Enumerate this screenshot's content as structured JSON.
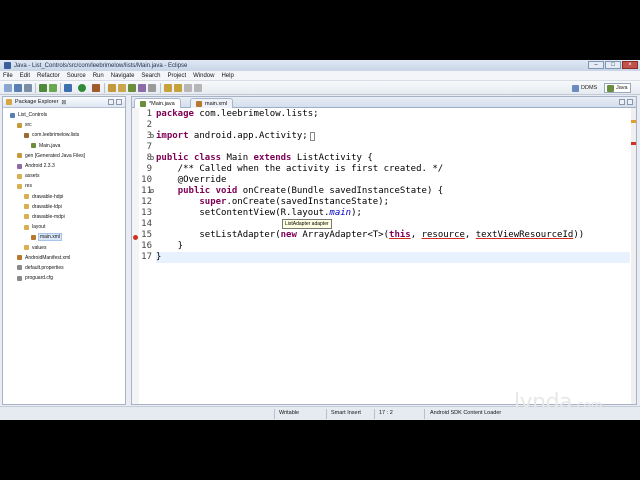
{
  "window": {
    "title": "Java - List_Controls/src/com/leebrimelow/lists/Main.java - Eclipse"
  },
  "menu": [
    "File",
    "Edit",
    "Refactor",
    "Source",
    "Run",
    "Navigate",
    "Search",
    "Project",
    "Window",
    "Help"
  ],
  "perspectives": [
    "DDMS",
    "Java"
  ],
  "explorer": {
    "title": "Package Explorer",
    "items": [
      {
        "label": "List_Controls",
        "depth": 1,
        "icon": "project-icon",
        "color": "#5a7fb8"
      },
      {
        "label": "src",
        "depth": 2,
        "icon": "source-folder-icon",
        "color": "#c49a3a"
      },
      {
        "label": "com.leebrimelow.lists",
        "depth": 3,
        "icon": "package-icon",
        "color": "#9a6a2e"
      },
      {
        "label": "Main.java",
        "depth": 4,
        "icon": "java-file-icon",
        "color": "#6c8d3b"
      },
      {
        "label": "gen [Generated Java Files]",
        "depth": 2,
        "icon": "source-folder-icon",
        "color": "#c49a3a"
      },
      {
        "label": "Android 2.3.3",
        "depth": 2,
        "icon": "library-icon",
        "color": "#8c6aa8"
      },
      {
        "label": "assets",
        "depth": 2,
        "icon": "folder-icon",
        "color": "#d9b050"
      },
      {
        "label": "res",
        "depth": 2,
        "icon": "folder-icon",
        "color": "#d9b050"
      },
      {
        "label": "drawable-hdpi",
        "depth": 3,
        "icon": "folder-icon",
        "color": "#d9b050"
      },
      {
        "label": "drawable-ldpi",
        "depth": 3,
        "icon": "folder-icon",
        "color": "#d9b050"
      },
      {
        "label": "drawable-mdpi",
        "depth": 3,
        "icon": "folder-icon",
        "color": "#d9b050"
      },
      {
        "label": "layout",
        "depth": 3,
        "icon": "folder-icon",
        "color": "#d9b050"
      },
      {
        "label": "main.xml",
        "depth": 4,
        "icon": "xml-file-icon",
        "color": "#b57a2e",
        "selected": true
      },
      {
        "label": "values",
        "depth": 3,
        "icon": "folder-icon",
        "color": "#d9b050"
      },
      {
        "label": "AndroidManifest.xml",
        "depth": 2,
        "icon": "xml-file-icon",
        "color": "#b57a2e"
      },
      {
        "label": "default.properties",
        "depth": 2,
        "icon": "file-icon",
        "color": "#8a8a8a"
      },
      {
        "label": "proguard.cfg",
        "depth": 2,
        "icon": "file-icon",
        "color": "#8a8a8a"
      }
    ]
  },
  "editor": {
    "tabs": [
      {
        "label": "*Main.java",
        "active": true
      },
      {
        "label": "main.xml",
        "active": false
      }
    ],
    "line_numbers": [
      "1",
      "2",
      "3",
      "7",
      "8",
      "9",
      "10",
      "11",
      "12",
      "13",
      "14",
      "15",
      "16",
      "17"
    ],
    "code": {
      "l1_kw": "package",
      "l1_rest": " com.leebrimelow.lists;",
      "l3_kw": "import",
      "l3_rest": " android.app.Activity;",
      "l8_kw1": "public",
      "l8_kw2": "class",
      "l8_mid": " Main ",
      "l8_kw3": "extends",
      "l8_rest": " ListActivity {",
      "l9": "    /** Called when the activity is first created. */",
      "l10": "    @Override",
      "l11_kw1": "public",
      "l11_kw2": "void",
      "l11_rest": " onCreate(Bundle savedInstanceState) {",
      "l12_kw": "super",
      "l12_rest": ".onCreate(savedInstanceState);",
      "l13_a": "setContentView(R.layout.",
      "l13_it": "main",
      "l13_b": ");",
      "l15_a": "setListAdapter(",
      "l15_kw1": "new",
      "l15_b": " ArrayAdapter<T>(",
      "l15_kw2": "this",
      "l15_c": ", ",
      "l15_u1": "resource",
      "l15_d": ", ",
      "l15_u2": "textViewResourceId",
      "l15_e": "))",
      "l16": "    }",
      "l17": "}"
    },
    "tooltip": "ListAdapter adapter"
  },
  "status": {
    "mode": "Writable",
    "insert": "Smart Insert",
    "position": "17 : 2",
    "loader": "Android SDK Content Loader"
  },
  "watermark": {
    "brand": "lynda",
    "suffix": ".com"
  },
  "colors": {
    "keyword": "#7f0055",
    "comment": "#3f5fbf",
    "selection": "#d9e6f7",
    "current_line": "#e8f2fe"
  }
}
